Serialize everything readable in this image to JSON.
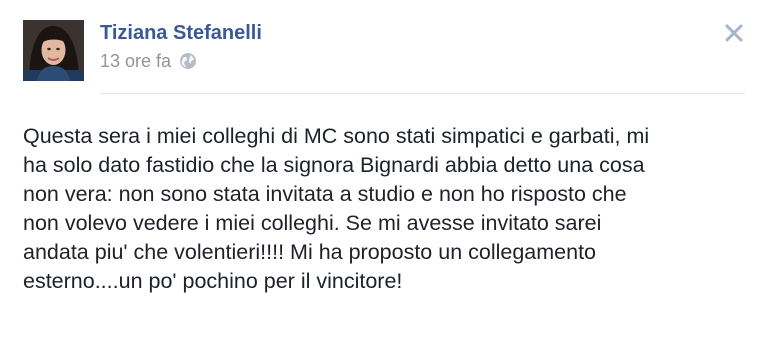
{
  "post": {
    "author": "Tiziana Stefanelli",
    "timestamp": "13 ore fa",
    "privacy_icon": "globe-icon",
    "close_icon": "close-icon",
    "message_lines": [
      "Questa sera i miei colleghi di MC sono stati simpatici e garbati, mi",
      "ha solo dato fastidio che la signora Bignardi abbia detto una cosa",
      "non vera: non sono stata invitata a studio e non ho risposto che",
      "non volevo vedere i miei colleghi. Se mi avesse invitato sarei",
      "andata piu' che volentieri!!!! Mi ha proposto un collegamento",
      "esterno....un po' pochino per il vincitore!"
    ]
  },
  "colors": {
    "author_link": "#3b5998",
    "meta_text": "#90949c",
    "body_text": "#1d2129",
    "divider": "#e5e5e5",
    "close_icon": "#a7b4c8"
  }
}
